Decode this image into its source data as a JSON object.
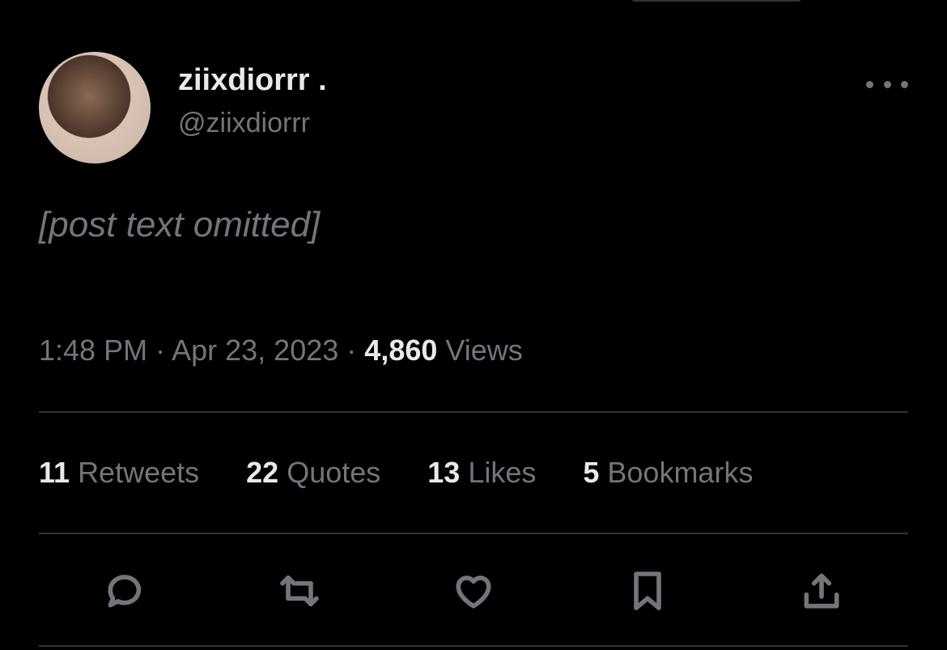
{
  "tweet": {
    "author": {
      "display_name": "ziixdiorrr .",
      "handle": "@ziixdiorrr"
    },
    "body_placeholder": "[post text omitted]",
    "time": "1:48 PM",
    "date": "Apr 23, 2023",
    "views_count": "4,860",
    "views_label": "Views",
    "sep": "·"
  },
  "stats": [
    {
      "count": "11",
      "label": "Retweets"
    },
    {
      "count": "22",
      "label": "Quotes"
    },
    {
      "count": "13",
      "label": "Likes"
    },
    {
      "count": "5",
      "label": "Bookmarks"
    }
  ],
  "actions": [
    {
      "icon": "reply-icon"
    },
    {
      "icon": "retweet-icon"
    },
    {
      "icon": "like-icon"
    },
    {
      "icon": "bookmark-icon"
    },
    {
      "icon": "share-icon"
    }
  ],
  "colors": {
    "background": "#000000",
    "text_primary": "#e7e9ea",
    "text_secondary": "#71767b",
    "divider": "#2f3336"
  }
}
